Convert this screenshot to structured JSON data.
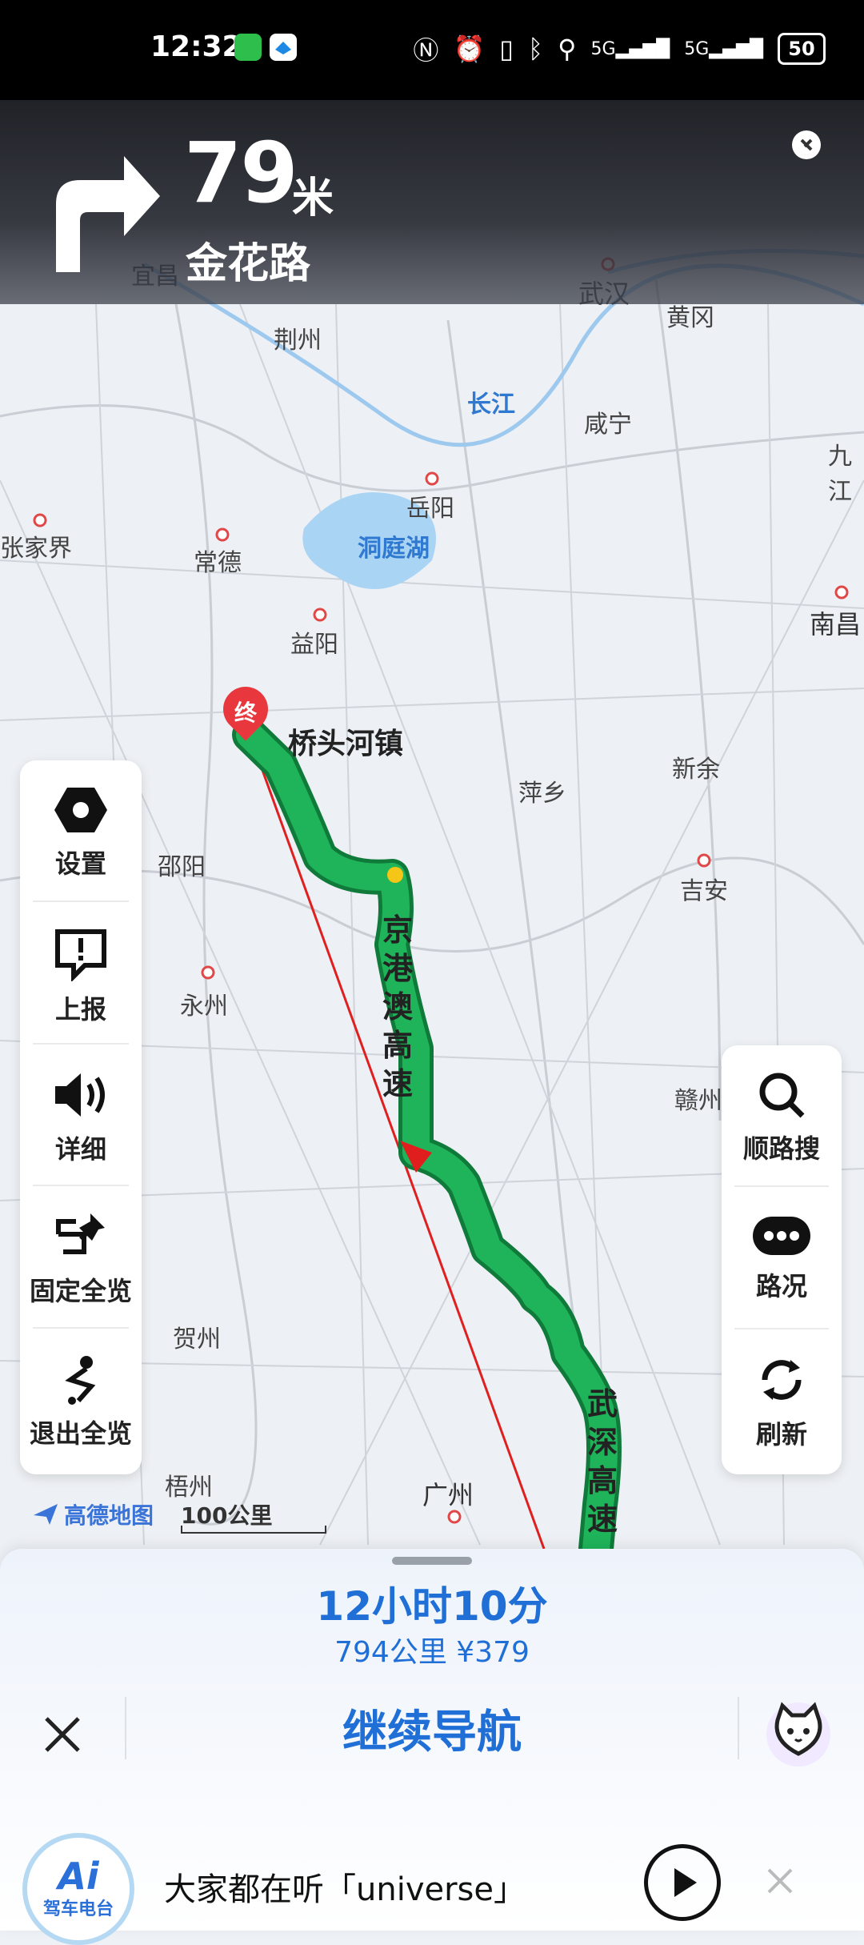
{
  "status_bar": {
    "time": "12:32",
    "battery": "50",
    "icons": [
      "messages-icon",
      "app-icon",
      "nfc-icon",
      "alarm-icon",
      "vibrate-icon",
      "bluetooth-icon",
      "location-icon",
      "signal-5g-icon",
      "signal-5g-icon"
    ]
  },
  "nav": {
    "distance": "79",
    "unit": "米",
    "road": "金花路",
    "next_turn": "turn-right-icon"
  },
  "map": {
    "cities": [
      {
        "name": "荆州"
      },
      {
        "name": "武汉"
      },
      {
        "name": "黄冈"
      },
      {
        "name": "宜昌"
      },
      {
        "name": "长江"
      },
      {
        "name": "咸宁"
      },
      {
        "name": "九江"
      },
      {
        "name": "岳阳"
      },
      {
        "name": "张家界"
      },
      {
        "name": "常德"
      },
      {
        "name": "洞庭湖"
      },
      {
        "name": "南昌"
      },
      {
        "name": "益阳"
      },
      {
        "name": "桥头河镇"
      },
      {
        "name": "萍乡"
      },
      {
        "name": "新余"
      },
      {
        "name": "邵阳"
      },
      {
        "name": "吉安"
      },
      {
        "name": "永州"
      },
      {
        "name": "赣州"
      },
      {
        "name": "贺州"
      },
      {
        "name": "梧州"
      },
      {
        "name": "广州"
      }
    ],
    "destination_marker": "终",
    "highway_1": [
      "京",
      "港",
      "澳",
      "高",
      "速"
    ],
    "highway_2": [
      "武",
      "深",
      "高",
      "速"
    ],
    "logo": "高德地图",
    "scale": "100公里"
  },
  "left_panel": {
    "settings": "设置",
    "report": "上报",
    "detail": "详细",
    "fix_overview": "固定全览",
    "exit_overview": "退出全览"
  },
  "right_panel": {
    "search_along": "顺路搜",
    "traffic": "路况",
    "refresh": "刷新"
  },
  "sheet": {
    "eta": "12小时10分",
    "route_info": "794公里 ¥379",
    "continue": "继续导航"
  },
  "radio": {
    "badge_main": "Ai",
    "badge_sub": "驾车电台",
    "text": "大家都在听「universe」"
  },
  "colors": {
    "route_green": "#1fb45a",
    "accent_blue": "#1f6fd6",
    "straight_line_red": "#e02020"
  }
}
